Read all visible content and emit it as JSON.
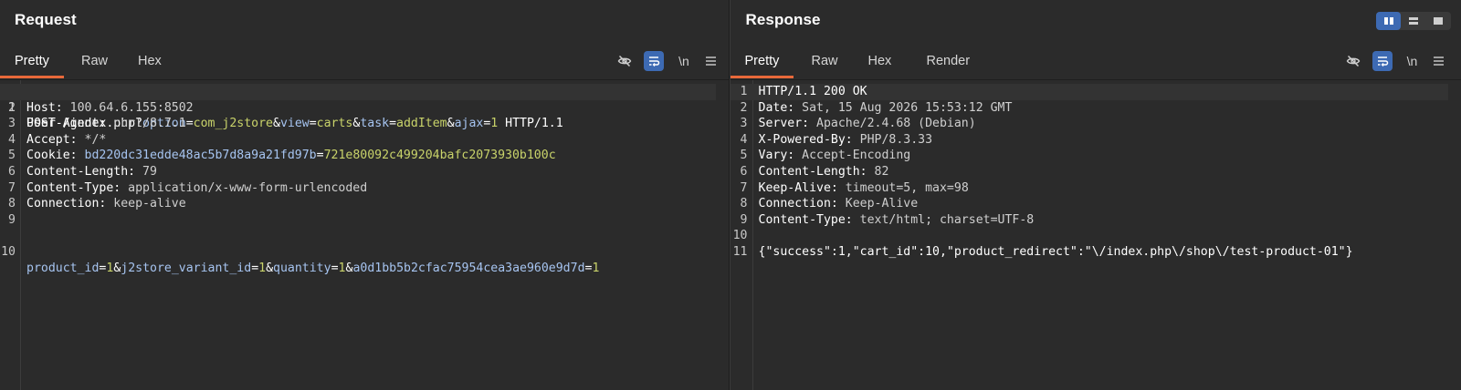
{
  "request": {
    "title": "Request",
    "tabs": [
      "Pretty",
      "Raw",
      "Hex"
    ],
    "active_tab": "Pretty",
    "tools": {
      "hide_icon": "eye-slash-icon",
      "wrap_icon": "wrap-lines-icon",
      "newline_label": "\\n",
      "menu_icon": "hamburger-menu-icon"
    },
    "lines": [
      {
        "n": "1",
        "method": "POST",
        "path": " /index.php?",
        "params": [
          [
            "option",
            "com_j2store"
          ],
          [
            "view",
            "carts"
          ],
          [
            "task",
            "addItem"
          ],
          [
            "ajax",
            "1"
          ]
        ],
        "proto": " HTTP/1.1"
      },
      {
        "n": "2",
        "key": "Host:",
        "val": " 100.64.6.155:8502"
      },
      {
        "n": "3",
        "key": "User-Agent:",
        "val": " curl/8.7.1"
      },
      {
        "n": "4",
        "key": "Accept:",
        "val": " */*"
      },
      {
        "n": "5",
        "key": "Cookie:",
        "ck": "bd220dc31edde48ac5b7d8a9a21fd97b",
        "cv": "721e80092c499204bafc2073930b100c"
      },
      {
        "n": "6",
        "key": "Content-Length:",
        "val": " 79"
      },
      {
        "n": "7",
        "key": "Content-Type:",
        "val": " application/x-www-form-urlencoded"
      },
      {
        "n": "8",
        "key": "Connection:",
        "val": " keep-alive"
      },
      {
        "n": "9"
      },
      {
        "n": "10",
        "body": [
          [
            "product_id",
            "1"
          ],
          [
            "j2store_variant_id",
            "1"
          ],
          [
            "quantity",
            "1"
          ],
          [
            "a0d1bb5b2cfac75954cea3ae960e9d7d",
            "1"
          ]
        ]
      }
    ]
  },
  "response": {
    "title": "Response",
    "tabs": [
      "Pretty",
      "Raw",
      "Hex",
      "Render"
    ],
    "active_tab": "Pretty",
    "tools": {
      "hide_icon": "eye-slash-icon",
      "wrap_icon": "wrap-lines-icon",
      "newline_label": "\\n",
      "menu_icon": "hamburger-menu-icon"
    },
    "lines": [
      {
        "n": "1",
        "text": "HTTP/1.1 200 OK"
      },
      {
        "n": "2",
        "key": "Date:",
        "val": " Sat, 15 Aug 2026 15:53:12 GMT"
      },
      {
        "n": "3",
        "key": "Server:",
        "val": " Apache/2.4.68 (Debian)"
      },
      {
        "n": "4",
        "key": "X-Powered-By:",
        "val": " PHP/8.3.33"
      },
      {
        "n": "5",
        "key": "Vary:",
        "val": " Accept-Encoding"
      },
      {
        "n": "6",
        "key": "Content-Length:",
        "val": " 82"
      },
      {
        "n": "7",
        "key": "Keep-Alive:",
        "val": " timeout=5, max=98"
      },
      {
        "n": "8",
        "key": "Connection:",
        "val": " Keep-Alive"
      },
      {
        "n": "9",
        "key": "Content-Type:",
        "val": " text/html; charset=UTF-8"
      },
      {
        "n": "10"
      },
      {
        "n": "11",
        "text": "{\"success\":1,\"cart_id\":10,\"product_redirect\":\"\\/index.php\\/shop\\/test-product-01\"}"
      }
    ]
  },
  "layout_switch": {
    "icons": [
      "side-by-side-icon",
      "stacked-icon",
      "single-pane-icon"
    ],
    "active": 0
  },
  "colors": {
    "accent_tab": "#e8693a",
    "toolbar_active": "#3d6ab3",
    "param_name": "#a6c4f0",
    "param_value": "#c9d36a"
  }
}
